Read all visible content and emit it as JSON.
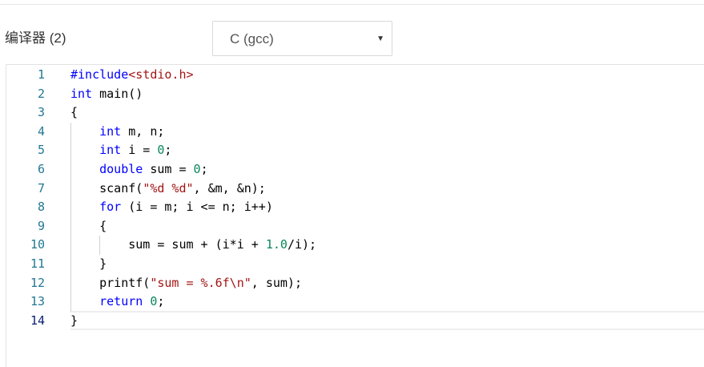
{
  "compiler": {
    "label": "编译器 (2)",
    "selected": "C (gcc)",
    "caret_icon": "triangle-down"
  },
  "editor": {
    "active_line": 14,
    "lines": [
      "#include<stdio.h>",
      "int main()",
      "{",
      "    int m, n;",
      "    int i = 0;",
      "    double sum = 0;",
      "    scanf(\"%d %d\", &m, &n);",
      "    for (i = m; i <= n; i++)",
      "    {",
      "        sum = sum + (i*i + 1.0/i);",
      "    }",
      "    printf(\"sum = %.6f\\n\", sum);",
      "    return 0;",
      "}"
    ]
  },
  "colors": {
    "keyword": "#0000ff",
    "string": "#a31515",
    "number": "#098658",
    "line_number": "#237893",
    "active_line_number": "#0b216f"
  }
}
